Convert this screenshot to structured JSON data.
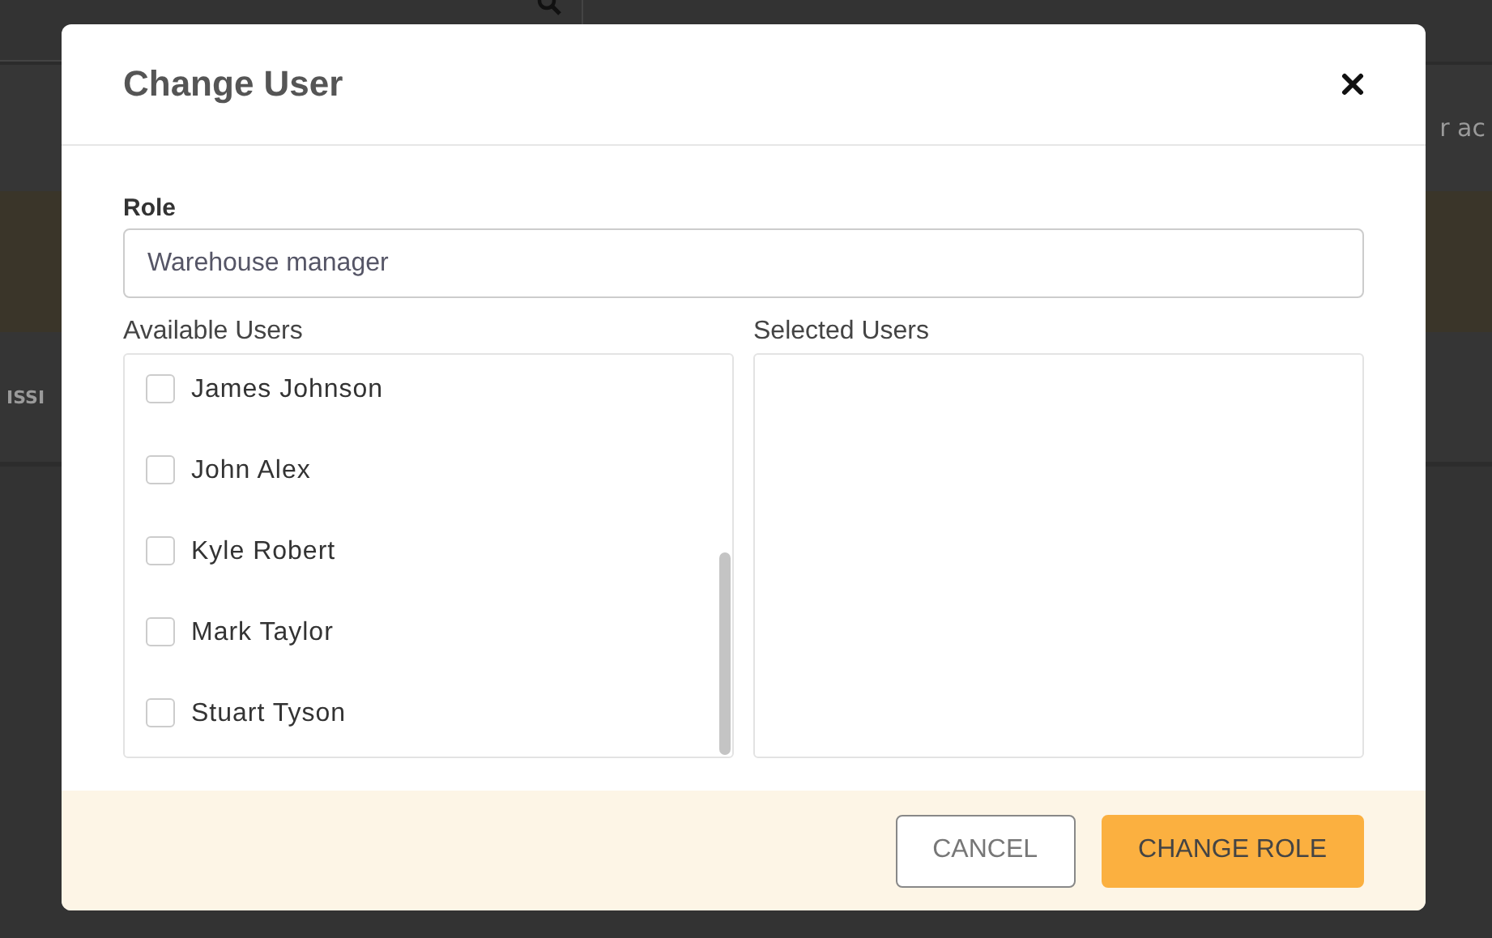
{
  "background": {
    "tab_fragment": "ISSI",
    "text_fragment": "r ac"
  },
  "dialog": {
    "title": "Change User",
    "role": {
      "label": "Role",
      "value": "Warehouse manager"
    },
    "available_users": {
      "label": "Available Users",
      "items": [
        {
          "name": "James Johnson",
          "checked": false
        },
        {
          "name": "John Alex",
          "checked": false
        },
        {
          "name": "Kyle Robert",
          "checked": false
        },
        {
          "name": "Mark Taylor",
          "checked": false
        },
        {
          "name": "Stuart Tyson",
          "checked": false
        }
      ]
    },
    "selected_users": {
      "label": "Selected Users"
    },
    "buttons": [
      {
        "label": "CANCEL",
        "kind": "secondary"
      },
      {
        "label": "CHANGE ROLE",
        "kind": "primary"
      }
    ]
  }
}
